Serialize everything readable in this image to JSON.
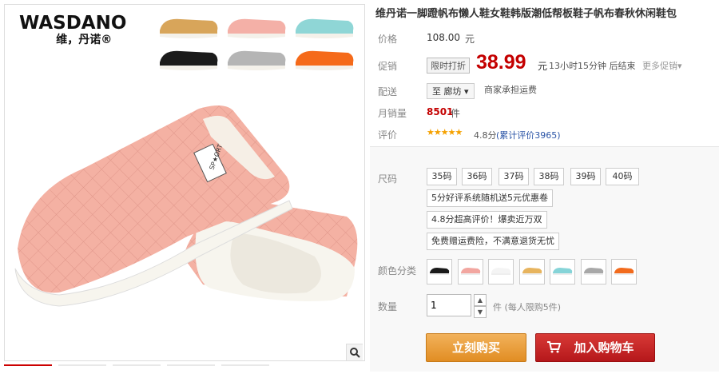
{
  "brand": {
    "logo_en": "WASDANO",
    "logo_cn": "维，丹诺®"
  },
  "product": {
    "title": "维丹诺一脚蹬帆布懒人鞋女鞋韩版潮低帮板鞋子帆布春秋休闲鞋包"
  },
  "price": {
    "label": "价格",
    "original": "108.00",
    "unit": "元"
  },
  "promo": {
    "label": "促销",
    "tag": "限时打折",
    "price": "38.99",
    "unit": "元",
    "countdown": "13小时15分钟 后结束",
    "more": "更多促销▾"
  },
  "shipping": {
    "label": "配送",
    "destination": "至 廊坊 ▾",
    "note": "商家承担运费"
  },
  "sales": {
    "label": "月销量",
    "count": "8501",
    "unit": "件"
  },
  "review": {
    "label": "评价",
    "stars": "★★★★★",
    "score": "4.8分",
    "link": "(累计评价3965)"
  },
  "sku": {
    "size_label": "尺码",
    "sizes": [
      "35码",
      "36码",
      "37码",
      "38码",
      "39码",
      "40码"
    ],
    "promos": [
      "5分好评系统随机送5元优惠卷",
      "4.8分超高评价！爆卖近万双",
      "免费赠运费险，不满意退货无忧"
    ],
    "color_label": "颜色分类",
    "colors": [
      "#1a1a1a",
      "#f2a6a0",
      "#f4f4f4",
      "#e7b45e",
      "#86d4d8",
      "#a8a8a8",
      "#f26b1d"
    ],
    "qty_label": "数量",
    "qty_value": "1",
    "qty_limit": "件 (每人限购5件)",
    "up_arrow": "▲",
    "down_arrow": "▼"
  },
  "actions": {
    "buy_now": "立刻购买",
    "add_cart": "加入购物车"
  }
}
